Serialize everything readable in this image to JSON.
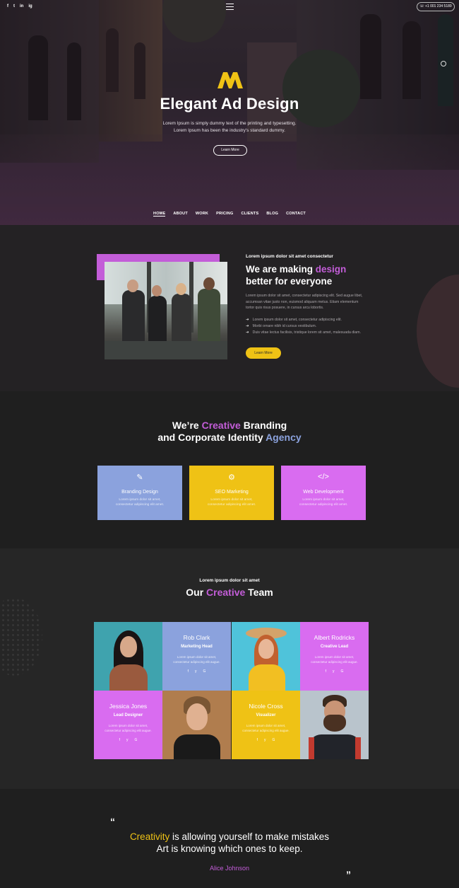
{
  "header": {
    "social": [
      "f",
      "t",
      "in",
      "ig"
    ],
    "phone": "+1 001 234 5189",
    "logo_text": "M"
  },
  "hero": {
    "title": "Elegant Ad Design",
    "subtitle": "Lorem Ipsum is simply dummy text of the printing and typesetting. Lorem Ipsum has been the industry's standard dummy.",
    "button": "Learn More",
    "nav": [
      "HOME",
      "ABOUT",
      "WORK",
      "PRICING",
      "CLIENTS",
      "BLOG",
      "CONTACT"
    ]
  },
  "about": {
    "kicker": "Lorem ipsum dolor sit amet consectetur",
    "title_pre": "We are making ",
    "title_highlight": "design",
    "title_post": "better for everyone",
    "text": "Lorem ipsum dolor sit amet, consectetur adipiscing elit. Sed augue libet, accumsan vitae justo non, euismod aliquam metus. Etiam elementum tortor quis risus posuere, in cursus arcu lobortis.",
    "list": [
      "Lorem ipsum dolor sit amet, consectetur adipiscing elit.",
      "Morbi ornare nibh id cursus vestibulum.",
      "Duis vitae lectus facilisis, tristique lorem sit amet, malesuada diam."
    ],
    "button": "Learn More"
  },
  "services": {
    "title_line1_pre": "We’re ",
    "title_line1_highlight": "Creative",
    "title_line1_post": " Branding",
    "title_line2_pre": "and Corporate Identity ",
    "title_line2_highlight": "Agency",
    "cards": [
      {
        "name": "Branding Design",
        "desc": "Lorem ipsum dolor sit amet, consectetur adipiscing elit amet.",
        "icon": "pencil-icon",
        "color": "#8ba2dd"
      },
      {
        "name": "SEO Marketing",
        "desc": "Lorem ipsum dolor sit amet, consectetur adipiscing elit amet.",
        "icon": "gear-icon",
        "color": "#efc215"
      },
      {
        "name": "Web Development",
        "desc": "Lorem ipsum dolor sit amet, consectetur adipiscing elit amet.",
        "icon": "code-icon",
        "color": "#d96cf0"
      }
    ]
  },
  "team": {
    "kicker": "Lorem ipsum dolor sit amet",
    "title_pre": "Our ",
    "title_highlight": "Creative",
    "title_post": " Team",
    "members": [
      {
        "name": "Rob Clark",
        "role": "Marketing Head",
        "desc": "Lorem ipsum dolor sit amet, consectetur adipiscing elit augue.",
        "color": "#8ba2dd"
      },
      {
        "name": "Albert Rodricks",
        "role": "Creative Lead",
        "desc": "Lorem ipsum dolor sit amet, consectetur adipiscing elit augue.",
        "color": "#d96cf0"
      },
      {
        "name": "Jessica Jones",
        "role": "Lead Designer",
        "desc": "Lorem ipsum dolor sit amet, consectetur adipiscing elit augue.",
        "color": "#d96cf0"
      },
      {
        "name": "Nicole Cross",
        "role": "Visualizer",
        "desc": "Lorem ipsum dolor sit amet, consectetur adipiscing elit augue.",
        "color": "#efc215"
      }
    ],
    "social": [
      "f",
      "y",
      "G"
    ]
  },
  "quote": {
    "open": "“",
    "close": "”",
    "line1_highlight": "Creativity",
    "line1_post": " is allowing yourself to make mistakes",
    "line2": "Art is knowing which ones to keep.",
    "author": "Alice Johnson"
  },
  "colors": {
    "purple": "#c35dd8",
    "yellow": "#efc215",
    "blue": "#8ba2dd",
    "dark": "#222222"
  }
}
